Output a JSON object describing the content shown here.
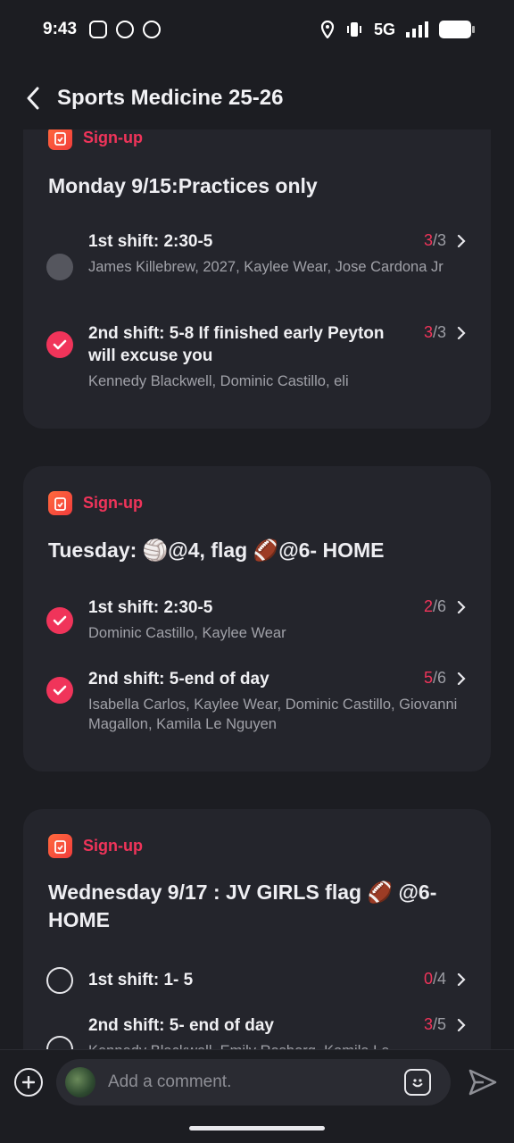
{
  "status_bar": {
    "time": "9:43",
    "network": "5G"
  },
  "header": {
    "title": "Sports Medicine 25-26"
  },
  "cards": [
    {
      "badge": "Sign-up",
      "title": "Monday 9/15:Practices only",
      "shifts": [
        {
          "title": "1st shift: 2:30-5",
          "names": "James Killebrew, 2027, Kaylee Wear, Jose Cardona Jr",
          "filled": "3",
          "total": "3",
          "state": "disabled"
        },
        {
          "title": "2nd shift: 5-8 If finished early Peyton will excuse you",
          "names": "Kennedy Blackwell, Dominic Castillo, eli",
          "filled": "3",
          "total": "3",
          "state": "checked"
        }
      ]
    },
    {
      "badge": "Sign-up",
      "title": "Tuesday:  🏐@4, flag 🏈@6- HOME",
      "shifts": [
        {
          "title": "1st shift: 2:30-5",
          "names": "Dominic Castillo, Kaylee Wear",
          "filled": "2",
          "total": "6",
          "state": "checked"
        },
        {
          "title": "2nd shift: 5-end of day",
          "names": "Isabella Carlos, Kaylee Wear, Dominic Castillo, Giovanni Magallon, Kamila Le Nguyen",
          "filled": "5",
          "total": "6",
          "state": "checked"
        }
      ]
    },
    {
      "badge": "Sign-up",
      "title": "Wednesday 9/17 :  JV GIRLS flag 🏈 @6-HOME",
      "shifts": [
        {
          "title": "1st shift: 1- 5",
          "names": "",
          "filled": "0",
          "total": "4",
          "state": "empty"
        },
        {
          "title": "2nd shift: 5- end of day",
          "names": "Kennedy Blackwell, Emily Rosborg, Kamila Le",
          "filled": "3",
          "total": "5",
          "state": "empty"
        }
      ]
    }
  ],
  "comment_bar": {
    "placeholder": "Add a comment."
  },
  "colors": {
    "accent": "#f0345a",
    "background": "#1c1d22",
    "card": "#24252c"
  }
}
